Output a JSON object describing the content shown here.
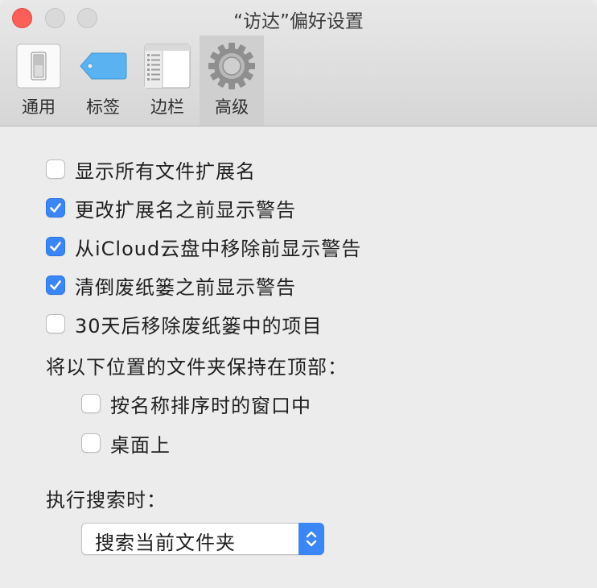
{
  "window": {
    "title": "“访达”偏好设置"
  },
  "toolbar": {
    "tabs": [
      {
        "label": "通用",
        "icon": "switch-icon",
        "active": false
      },
      {
        "label": "标签",
        "icon": "tag-icon",
        "active": false
      },
      {
        "label": "边栏",
        "icon": "sidebar-icon",
        "active": false
      },
      {
        "label": "高级",
        "icon": "gear-icon",
        "active": true
      }
    ]
  },
  "options": [
    {
      "label": "显示所有文件扩展名",
      "checked": false
    },
    {
      "label": "更改扩展名之前显示警告",
      "checked": true
    },
    {
      "label": "从iCloud云盘中移除前显示警告",
      "checked": true
    },
    {
      "label": "清倒废纸篓之前显示警告",
      "checked": true
    },
    {
      "label": "30天后移除废纸篓中的项目",
      "checked": false
    }
  ],
  "folders_top": {
    "heading": "将以下位置的文件夹保持在顶部：",
    "items": [
      {
        "label": "按名称排序时的窗口中",
        "checked": false
      },
      {
        "label": "桌面上",
        "checked": false
      }
    ]
  },
  "search": {
    "heading": "执行搜索时：",
    "selected": "搜索当前文件夹"
  },
  "colors": {
    "accent": "#3a86f5",
    "close": "#fc5f57"
  }
}
